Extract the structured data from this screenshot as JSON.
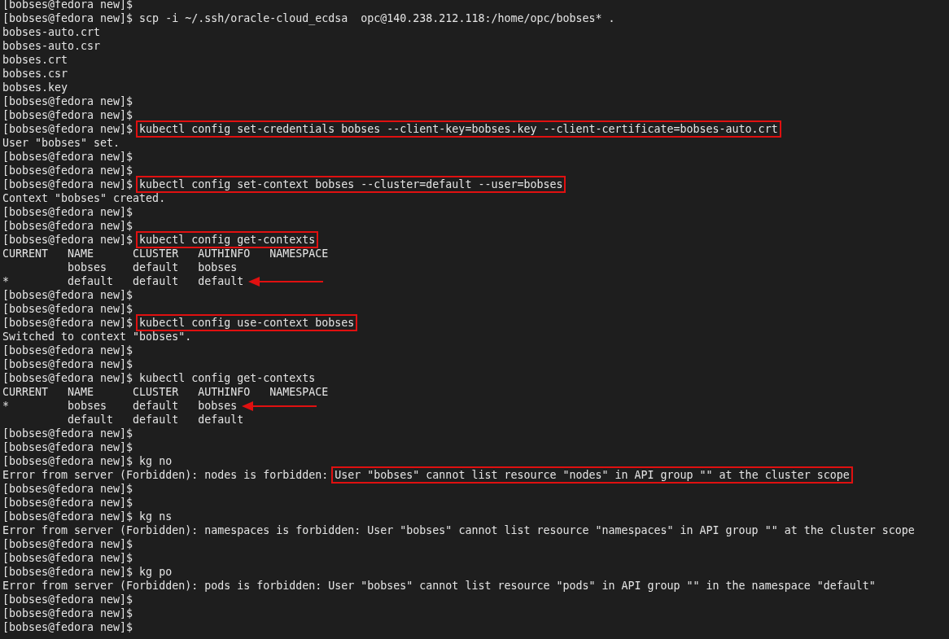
{
  "terminal": {
    "lines": [
      {
        "prompt": "[bobses@fedora new]$"
      },
      {
        "prompt": "[bobses@fedora new]$",
        "parts": [
          {
            "text": " scp -i ~/.ssh/oracle-cloud_ecdsa  opc@140.238.212.118:/home/opc/bobses* ."
          }
        ]
      },
      {
        "parts": [
          {
            "text": "bobses-auto.crt"
          }
        ]
      },
      {
        "parts": [
          {
            "text": "bobses-auto.csr"
          }
        ]
      },
      {
        "parts": [
          {
            "text": "bobses.crt"
          }
        ]
      },
      {
        "parts": [
          {
            "text": "bobses.csr"
          }
        ]
      },
      {
        "parts": [
          {
            "text": "bobses.key"
          }
        ]
      },
      {
        "prompt": "[bobses@fedora new]$"
      },
      {
        "prompt": "[bobses@fedora new]$"
      },
      {
        "prompt": "[bobses@fedora new]$",
        "parts": [
          {
            "text": "kubectl config set-credentials bobses --client-key=bobses.key --client-certificate=bobses-auto.crt",
            "boxed": true
          }
        ]
      },
      {
        "parts": [
          {
            "text": "User \"bobses\" set."
          }
        ]
      },
      {
        "prompt": "[bobses@fedora new]$"
      },
      {
        "prompt": "[bobses@fedora new]$"
      },
      {
        "prompt": "[bobses@fedora new]$",
        "parts": [
          {
            "text": "kubectl config set-context bobses --cluster=default --user=bobses",
            "boxed": true
          }
        ]
      },
      {
        "parts": [
          {
            "text": "Context \"bobses\" created."
          }
        ]
      },
      {
        "prompt": "[bobses@fedora new]$"
      },
      {
        "prompt": "[bobses@fedora new]$"
      },
      {
        "prompt": "[bobses@fedora new]$",
        "parts": [
          {
            "text": "kubectl config get-contexts",
            "boxed": true
          }
        ]
      },
      {
        "parts": [
          {
            "text": "CURRENT   NAME      CLUSTER   AUTHINFO   NAMESPACE"
          }
        ]
      },
      {
        "parts": [
          {
            "text": "          bobses    default   bobses"
          }
        ]
      },
      {
        "parts": [
          {
            "text": "*         default   default   default"
          }
        ],
        "arrow": true
      },
      {
        "prompt": "[bobses@fedora new]$"
      },
      {
        "prompt": "[bobses@fedora new]$"
      },
      {
        "prompt": "[bobses@fedora new]$",
        "parts": [
          {
            "text": "kubectl config use-context bobses",
            "boxed": true
          }
        ]
      },
      {
        "parts": [
          {
            "text": "Switched to context \"bobses\"."
          }
        ]
      },
      {
        "prompt": "[bobses@fedora new]$"
      },
      {
        "prompt": "[bobses@fedora new]$"
      },
      {
        "prompt": "[bobses@fedora new]$",
        "parts": [
          {
            "text": " kubectl config get-contexts"
          }
        ]
      },
      {
        "parts": [
          {
            "text": "CURRENT   NAME      CLUSTER   AUTHINFO   NAMESPACE"
          }
        ]
      },
      {
        "parts": [
          {
            "text": "*         bobses    default   bobses"
          }
        ],
        "arrow": true
      },
      {
        "parts": [
          {
            "text": "          default   default   default"
          }
        ]
      },
      {
        "prompt": "[bobses@fedora new]$"
      },
      {
        "prompt": "[bobses@fedora new]$"
      },
      {
        "prompt": "[bobses@fedora new]$",
        "parts": [
          {
            "text": " kg no"
          }
        ]
      },
      {
        "parts": [
          {
            "text": "Error from server (Forbidden): nodes is forbidden: "
          },
          {
            "text": "User \"bobses\" cannot list resource \"nodes\" in API group \"\" at the cluster scope",
            "boxed": true
          }
        ]
      },
      {
        "prompt": "[bobses@fedora new]$"
      },
      {
        "prompt": "[bobses@fedora new]$"
      },
      {
        "prompt": "[bobses@fedora new]$",
        "parts": [
          {
            "text": " kg ns"
          }
        ]
      },
      {
        "parts": [
          {
            "text": "Error from server (Forbidden): namespaces is forbidden: User \"bobses\" cannot list resource \"namespaces\" in API group \"\" at the cluster scope"
          }
        ]
      },
      {
        "prompt": "[bobses@fedora new]$"
      },
      {
        "prompt": "[bobses@fedora new]$"
      },
      {
        "prompt": "[bobses@fedora new]$",
        "parts": [
          {
            "text": " kg po"
          }
        ]
      },
      {
        "parts": [
          {
            "text": "Error from server (Forbidden): pods is forbidden: User \"bobses\" cannot list resource \"pods\" in API group \"\" in the namespace \"default\""
          }
        ]
      },
      {
        "prompt": "[bobses@fedora new]$"
      },
      {
        "prompt": "[bobses@fedora new]$"
      },
      {
        "prompt": "[bobses@fedora new]$"
      }
    ]
  }
}
